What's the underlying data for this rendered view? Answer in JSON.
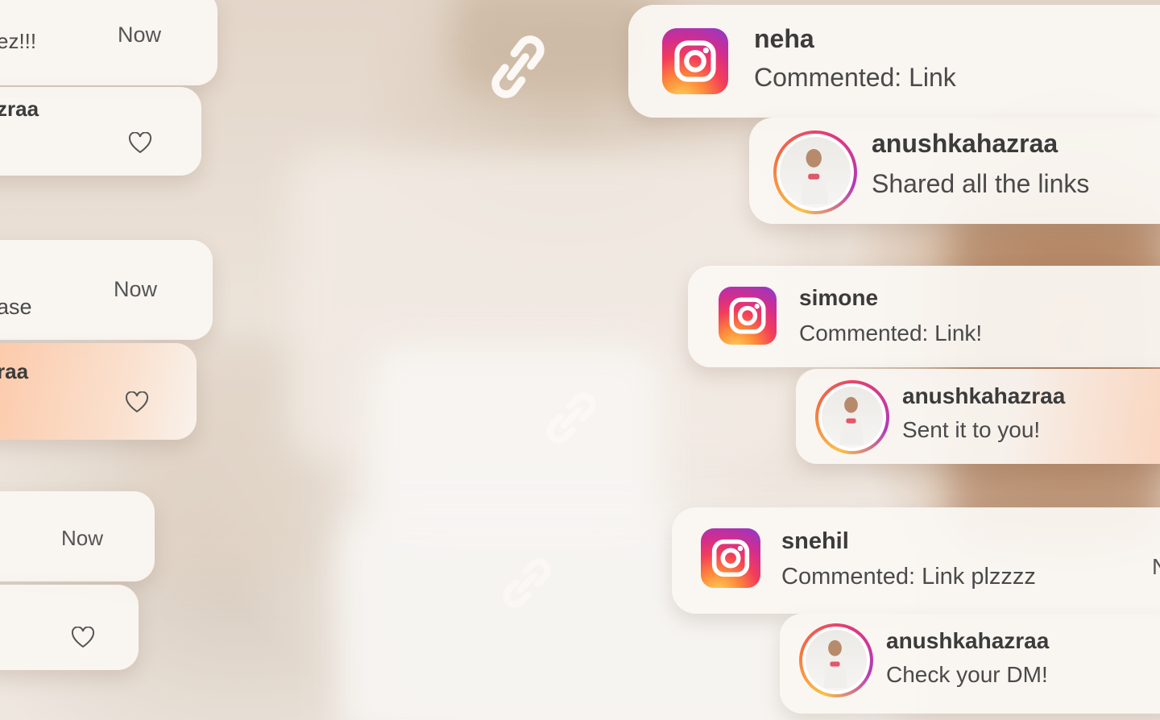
{
  "left_column": {
    "cards": [
      {
        "text": "ez!!!",
        "time": "Now"
      },
      {
        "text": "zraa"
      },
      {
        "text": "ase",
        "time": "Now"
      },
      {
        "text": "raa"
      },
      {
        "time": "Now"
      },
      {}
    ]
  },
  "notifications": [
    {
      "app_icon": "instagram-icon",
      "username": "neha",
      "message": "Commented: Link"
    },
    {
      "avatar": "profile-avatar",
      "username": "anushkahazraa",
      "message": "Shared all the links"
    },
    {
      "app_icon": "instagram-icon",
      "username": "simone",
      "message": "Commented: Link!"
    },
    {
      "avatar": "profile-avatar",
      "username": "anushkahazraa",
      "message": "Sent it to you!"
    },
    {
      "app_icon": "instagram-icon",
      "username": "snehil",
      "message": "Commented: Link plzzzz",
      "time": "N"
    },
    {
      "avatar": "profile-avatar",
      "username": "anushkahazraa",
      "message": "Check your DM!"
    }
  ],
  "decorations": {
    "link_icon": "chain-link-icon",
    "heart_icon": "heart-outline-icon"
  },
  "colors": {
    "card_bg": "#faf6f2",
    "accent_warm": "#fdd6be",
    "instagram_gradient": [
      "#fdd75a",
      "#fd8a3a",
      "#f33d5a",
      "#d22d8e",
      "#8a3ad0"
    ]
  }
}
